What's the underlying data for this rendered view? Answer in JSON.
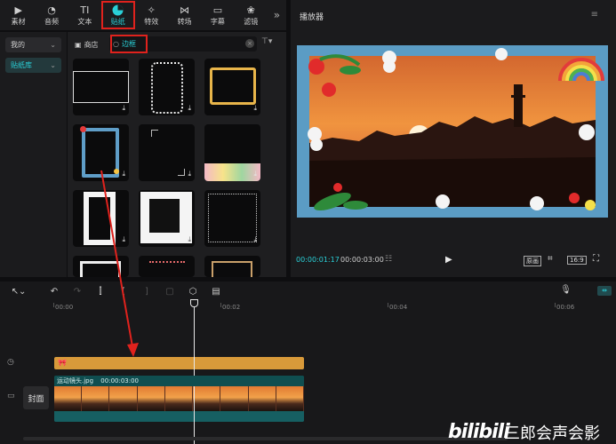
{
  "toolbar": {
    "tabs": [
      {
        "label": "素材",
        "icon": "media-icon"
      },
      {
        "label": "音频",
        "icon": "audio-icon"
      },
      {
        "label": "文本",
        "icon": "text-icon"
      },
      {
        "label": "贴纸",
        "icon": "sticker-icon",
        "active": true
      },
      {
        "label": "特效",
        "icon": "effects-icon"
      },
      {
        "label": "转场",
        "icon": "transition-icon"
      },
      {
        "label": "字幕",
        "icon": "subtitle-icon"
      },
      {
        "label": "滤镜",
        "icon": "filter-icon"
      }
    ],
    "more": "»"
  },
  "categories": {
    "mine": "我的",
    "library": "贴纸库"
  },
  "sticker_panel": {
    "store_label": "商店",
    "search_value": "边框",
    "clear": "×",
    "filter": "⊤▾"
  },
  "player": {
    "title": "播放器",
    "menu": "≡",
    "time_current": "00:00:01:17",
    "time_total": "00:00:03:00",
    "original_label": "原画",
    "ratio_label": "16:9"
  },
  "timeline": {
    "ruler": [
      "00:00",
      "00:02",
      "00:04",
      "00:06"
    ],
    "cover_label": "封面",
    "video_clip": {
      "name": "运动镜头.jpg",
      "duration": "00:00:03:00"
    },
    "sticker_clip_label": "🎀"
  },
  "watermark": {
    "logo": "bilibili",
    "text": "三郎会声会影"
  },
  "colors": {
    "accent": "#2ad0d8",
    "highlight": "#e0221d",
    "sticker_clip": "#d89a3a",
    "video_clip": "#0f4e50"
  }
}
